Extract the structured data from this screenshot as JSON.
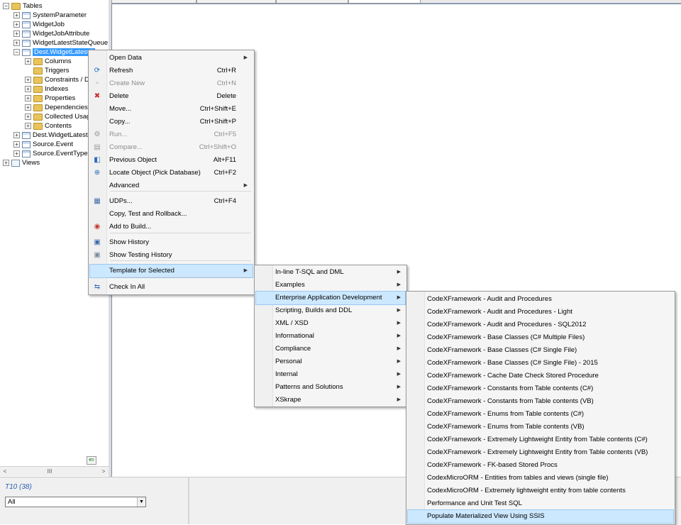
{
  "tree": {
    "items": [
      {
        "label": "Tables",
        "expander": "−",
        "icon": "folder"
      },
      {
        "label": "SystemParameter",
        "expander": "+",
        "icon": "table"
      },
      {
        "label": "WidgetJob",
        "expander": "+",
        "icon": "table"
      },
      {
        "label": "WidgetJobAttribute",
        "expander": "+",
        "icon": "table"
      },
      {
        "label": "WidgetLatestStateQueue",
        "expander": "+",
        "icon": "table"
      },
      {
        "label": "Dest.WidgetLatestS",
        "expander": "−",
        "icon": "table",
        "selected": true
      },
      {
        "label": "Columns",
        "expander": "+",
        "icon": "folder"
      },
      {
        "label": "Triggers",
        "expander": "",
        "icon": "folder"
      },
      {
        "label": "Constraints / De",
        "expander": "+",
        "icon": "folder"
      },
      {
        "label": "Indexes",
        "expander": "+",
        "icon": "folder"
      },
      {
        "label": "Properties",
        "expander": "+",
        "icon": "folder"
      },
      {
        "label": "Dependencies",
        "expander": "+",
        "icon": "folder"
      },
      {
        "label": "Collected Usag",
        "expander": "+",
        "icon": "folder"
      },
      {
        "label": "Contents",
        "expander": "+",
        "icon": "folder"
      },
      {
        "label": "Dest.WidgetLatestS",
        "expander": "+",
        "icon": "table"
      },
      {
        "label": "Source.Event",
        "expander": "+",
        "icon": "table"
      },
      {
        "label": "Source.EventType",
        "expander": "+",
        "icon": "table"
      },
      {
        "label": "Views",
        "expander": "+",
        "icon": "view"
      }
    ],
    "scroll_grip": "III",
    "scroll_left": "<",
    "scroll_right": ">",
    "collapse_arrow": "⇚"
  },
  "status": {
    "text": "T10 (38)",
    "filter_value": "All",
    "filter_arrow": "▼"
  },
  "context_menu": {
    "items": [
      {
        "label": "Open Data",
        "shortcut": "",
        "submenu": true,
        "icon": "",
        "icon_name": "none"
      },
      {
        "label": "Refresh",
        "shortcut": "Ctrl+R",
        "icon": "⟳",
        "icon_name": "refresh-icon",
        "icon_color": "#1a6fc4"
      },
      {
        "label": "Create New",
        "shortcut": "Ctrl+N",
        "disabled": true,
        "icon": "▫",
        "icon_name": "new-document-icon",
        "icon_color": "#999999"
      },
      {
        "label": "Delete",
        "shortcut": "Delete",
        "icon": "✖",
        "icon_name": "delete-icon",
        "icon_color": "#d12b2b"
      },
      {
        "label": "Move...",
        "shortcut": "Ctrl+Shift+E",
        "icon": "",
        "icon_name": "none"
      },
      {
        "label": "Copy...",
        "shortcut": "Ctrl+Shift+P",
        "icon": "",
        "icon_name": "none"
      },
      {
        "label": "Run...",
        "shortcut": "Ctrl+F5",
        "disabled": true,
        "icon": "⚙",
        "icon_name": "run-icon",
        "icon_color": "#9a9a9a"
      },
      {
        "label": "Compare...",
        "shortcut": "Ctrl+Shift+O",
        "disabled": true,
        "icon": "▤",
        "icon_name": "compare-icon",
        "icon_color": "#9a9a9a"
      },
      {
        "label": "Previous Object",
        "shortcut": "Alt+F11",
        "icon": "◧",
        "icon_name": "previous-object-icon",
        "icon_color": "#2a6ab8"
      },
      {
        "label": "Locate Object (Pick Database)",
        "shortcut": "Ctrl+F2",
        "icon": "⊕",
        "icon_name": "locate-object-icon",
        "icon_color": "#2a6ab8"
      },
      {
        "label": "Advanced",
        "shortcut": "",
        "submenu": true,
        "icon": "",
        "icon_name": "none"
      },
      {
        "label": "UDPs...",
        "shortcut": "Ctrl+F4",
        "icon": "▦",
        "icon_name": "udps-icon",
        "icon_color": "#3c6aa8"
      },
      {
        "label": "Copy, Test and Rollback...",
        "shortcut": "",
        "icon": "",
        "icon_name": "none"
      },
      {
        "label": "Add to Build...",
        "shortcut": "",
        "icon": "◉",
        "icon_name": "add-to-build-icon",
        "icon_color": "#c0392b"
      },
      {
        "label": "Show History",
        "shortcut": "",
        "icon": "▣",
        "icon_name": "history-icon",
        "icon_color": "#3c6aa8"
      },
      {
        "label": "Show Testing History",
        "shortcut": "",
        "icon": "▣",
        "icon_name": "testing-history-icon",
        "icon_color": "#7a8aa0"
      },
      {
        "label": "Template for Selected",
        "shortcut": "",
        "submenu": true,
        "highlighted": true,
        "icon": "",
        "icon_name": "none"
      },
      {
        "label": "Check In All",
        "shortcut": "",
        "icon": "⇆",
        "icon_name": "check-in-icon",
        "icon_color": "#2a6ab8"
      }
    ]
  },
  "template_menu": {
    "items": [
      {
        "label": "In-line T-SQL and DML"
      },
      {
        "label": "Examples"
      },
      {
        "label": "Enterprise Application Development",
        "highlighted": true
      },
      {
        "label": "Scripting, Builds and DDL"
      },
      {
        "label": "XML / XSD"
      },
      {
        "label": "Informational"
      },
      {
        "label": "Compliance"
      },
      {
        "label": "Personal"
      },
      {
        "label": "Internal"
      },
      {
        "label": "Patterns and Solutions"
      },
      {
        "label": "XSkrape"
      }
    ]
  },
  "enterprise_menu": {
    "items": [
      {
        "label": "CodeXFramework - Audit and Procedures"
      },
      {
        "label": "CodeXFramework - Audit and Procedures - Light"
      },
      {
        "label": "CodeXFramework - Audit and Procedures - SQL2012"
      },
      {
        "label": "CodeXFramework - Base Classes (C# Multiple Files)"
      },
      {
        "label": "CodeXFramework - Base Classes (C# Single File)"
      },
      {
        "label": "CodeXFramework - Base Classes (C# Single File) - 2015"
      },
      {
        "label": "CodeXFramework - Cache Date Check Stored Procedure"
      },
      {
        "label": "CodeXFramework - Constants from Table contents (C#)"
      },
      {
        "label": "CodeXFramework - Constants from Table contents (VB)"
      },
      {
        "label": "CodeXFramework - Enums from Table contents (C#)"
      },
      {
        "label": "CodeXFramework - Enums from Table contents (VB)"
      },
      {
        "label": "CodeXFramework - Extremely Lightweight Entity from Table contents (C#)"
      },
      {
        "label": "CodeXFramework - Extremely Lightweight Entity from Table contents (VB)"
      },
      {
        "label": "CodeXFramework - FK-based Stored Procs"
      },
      {
        "label": "CodexMicroORM - Entities from tables and views (single file)"
      },
      {
        "label": "CodexMicroORM - Extremely lightweight entity from table contents"
      },
      {
        "label": "Performance and Unit Test SQL"
      },
      {
        "label": "Populate Materialized View Using SSIS",
        "highlighted": true
      }
    ]
  },
  "colors": {
    "selection": "#3399ff",
    "menu_highlight": "#cce8ff",
    "status_text": "#2b5fb4"
  }
}
